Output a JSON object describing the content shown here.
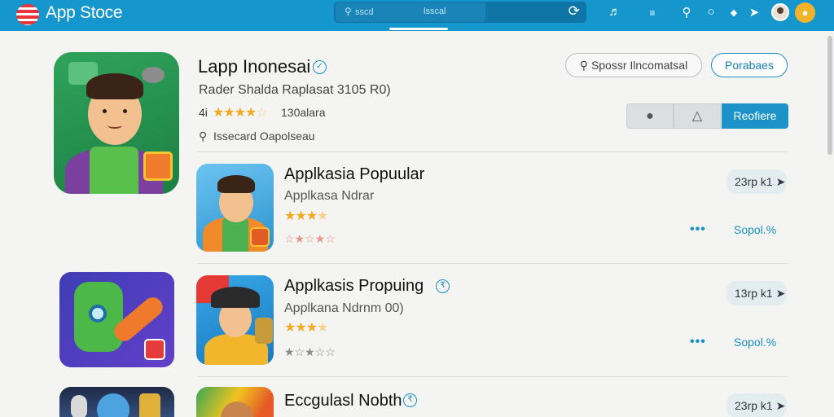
{
  "app": {
    "title": "App Stoce"
  },
  "search": {
    "placeholder": "sscd",
    "middle_text": "lsscal"
  },
  "hero": {
    "title": "Lapp Inonesai",
    "subtitle": "Rader Shalda Raplasat 3105 R0)",
    "rating_label": "4i",
    "rating": 3.5,
    "rating_count": "130alara",
    "search_hint": "Issecard Oapolseau",
    "search_button": "Spossr Ilncomatsal",
    "primary_button": "Porabaes",
    "action_button": "Reofiere"
  },
  "list": [
    {
      "title": "Applkasia Popuular",
      "subtitle": "Applkasa Ndrar",
      "rating": 3.5,
      "size": "23rp k1",
      "download": "Sopol.%"
    },
    {
      "title": "Applkasis Propuing",
      "subtitle": "Applkana Ndrnm  00)",
      "rating": 3.5,
      "size": "13rp k1",
      "download": "Sopol.%"
    },
    {
      "title": "Eccgulasl Nobth",
      "size": "23rp k1"
    }
  ],
  "icons": {
    "logo": "flag-logo-icon",
    "search": "search-icon",
    "refresh": "refresh-icon",
    "verify": "verified-badge-icon",
    "location": "location-pin-icon",
    "share": "share-icon",
    "more": "more-dots-icon"
  },
  "colors": {
    "accent": "#1596cc",
    "star": "#f2a81f",
    "button": "#1b93c9"
  }
}
